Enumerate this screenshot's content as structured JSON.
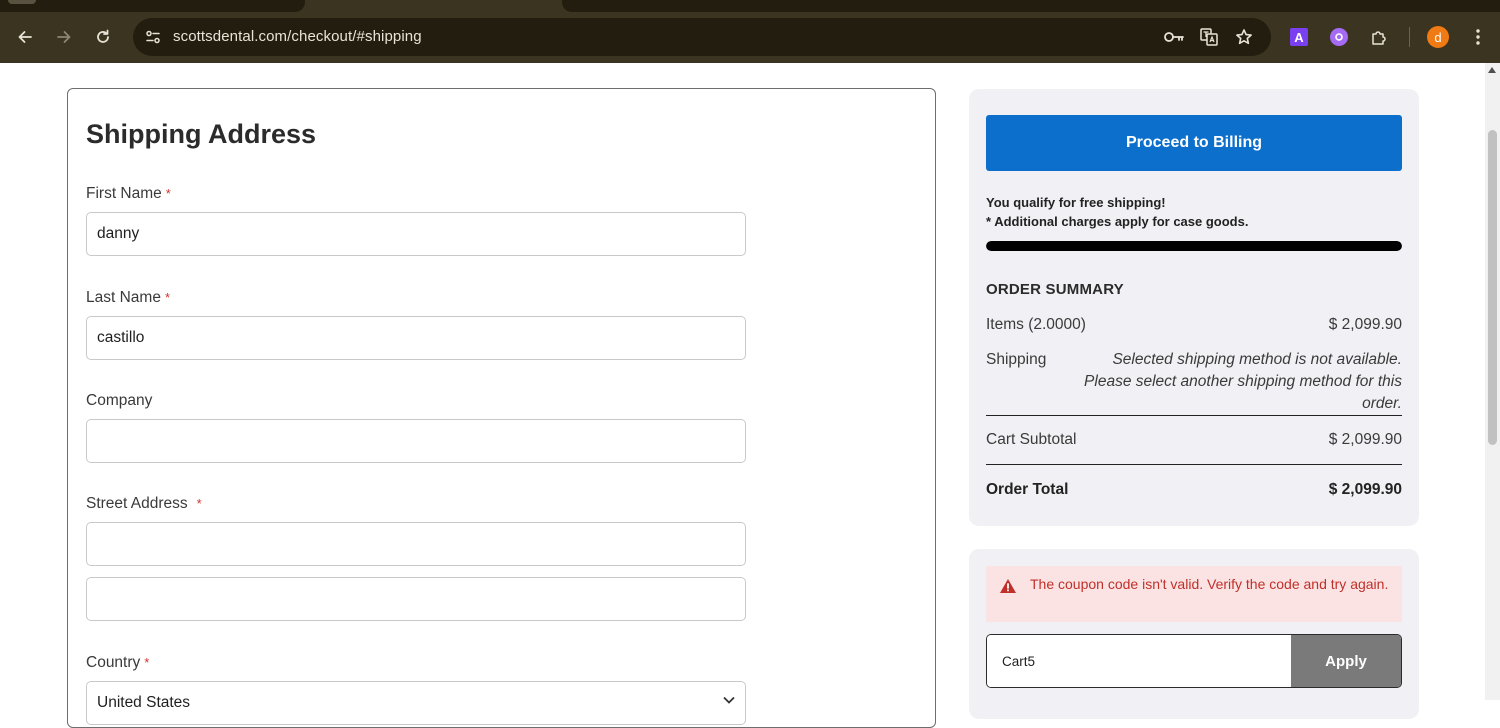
{
  "browser": {
    "url": "scottsdental.com/checkout/#shipping",
    "profile_initial": "d",
    "extension_a_label": "A"
  },
  "form": {
    "title": "Shipping Address",
    "required_mark": "*",
    "fields": {
      "first_name": {
        "label": "First Name",
        "value": "danny"
      },
      "last_name": {
        "label": "Last Name",
        "value": "castillo"
      },
      "company": {
        "label": "Company",
        "value": ""
      },
      "street": {
        "label": "Street Address",
        "value": "",
        "value2": ""
      },
      "country": {
        "label": "Country",
        "value": "United States"
      }
    }
  },
  "summary": {
    "proceed_label": "Proceed to Billing",
    "free_shipping_msg": "You qualify for free shipping!",
    "case_goods_note": "* Additional charges apply for case goods.",
    "free_shipping_progress": 1.0,
    "heading": "ORDER SUMMARY",
    "items_label": "Items (2.0000)",
    "items_value": "$ 2,099.90",
    "shipping_label": "Shipping",
    "shipping_note": "Selected shipping method is not available. Please select another shipping method for this order.",
    "subtotal_label": "Cart Subtotal",
    "subtotal_value": "$ 2,099.90",
    "total_label": "Order Total",
    "total_value": "$ 2,099.90"
  },
  "coupon": {
    "error": "The coupon code isn't valid. Verify the code and try again.",
    "code": "Cart5",
    "apply_label": "Apply"
  },
  "colors": {
    "primary_button": "#0b6fcb",
    "error_text": "#c0302a",
    "error_bg": "#fbe3e3",
    "required_star": "#d0342c"
  }
}
